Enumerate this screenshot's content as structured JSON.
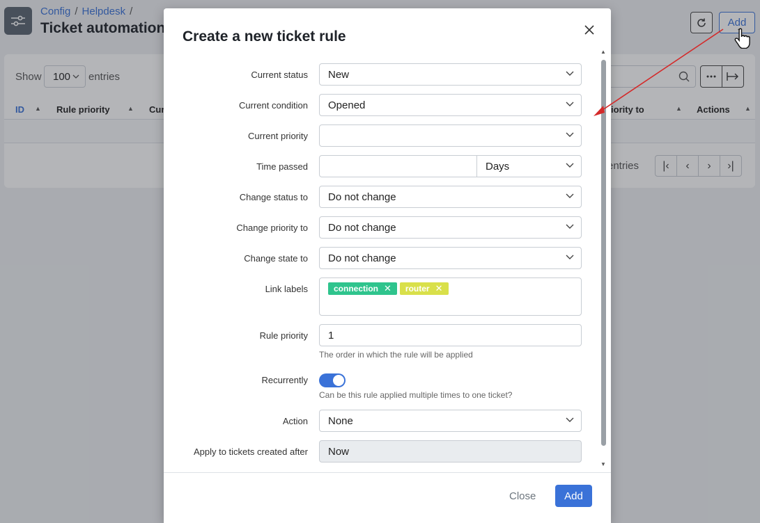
{
  "header": {
    "breadcrumb": [
      "Config",
      "Helpdesk"
    ],
    "title": "Ticket automation",
    "add_label": "Add"
  },
  "table": {
    "show_label": "Show",
    "entries_value": "100",
    "entries_label": "entries",
    "columns": [
      "ID",
      "Rule priority",
      "Cur",
      "riority to",
      "Actions"
    ],
    "info_text": "entries"
  },
  "modal": {
    "title": "Create a new ticket rule",
    "fields": {
      "current_status": {
        "label": "Current status",
        "value": "New"
      },
      "current_condition": {
        "label": "Current condition",
        "value": "Opened"
      },
      "current_priority": {
        "label": "Current priority",
        "value": ""
      },
      "time_passed": {
        "label": "Time passed",
        "value": "",
        "unit": "Days"
      },
      "change_status": {
        "label": "Change status to",
        "value": "Do not change"
      },
      "change_priority": {
        "label": "Change priority to",
        "value": "Do not change"
      },
      "change_state": {
        "label": "Change state to",
        "value": "Do not change"
      },
      "link_labels": {
        "label": "Link labels",
        "tags": [
          {
            "text": "connection",
            "color": "#2fc48d"
          },
          {
            "text": "router",
            "color": "#d9e04a"
          }
        ]
      },
      "rule_priority": {
        "label": "Rule priority",
        "value": "1",
        "help": "The order in which the rule will be applied"
      },
      "recurrently": {
        "label": "Recurrently",
        "enabled": true,
        "help": "Can be this rule applied multiple times to one ticket?"
      },
      "action": {
        "label": "Action",
        "value": "None"
      },
      "apply_after": {
        "label": "Apply to tickets created after",
        "value": "Now"
      }
    },
    "footer": {
      "close_label": "Close",
      "add_label": "Add"
    }
  },
  "colors": {
    "accent": "#3a72d8",
    "annotation": "#d42a2a"
  }
}
